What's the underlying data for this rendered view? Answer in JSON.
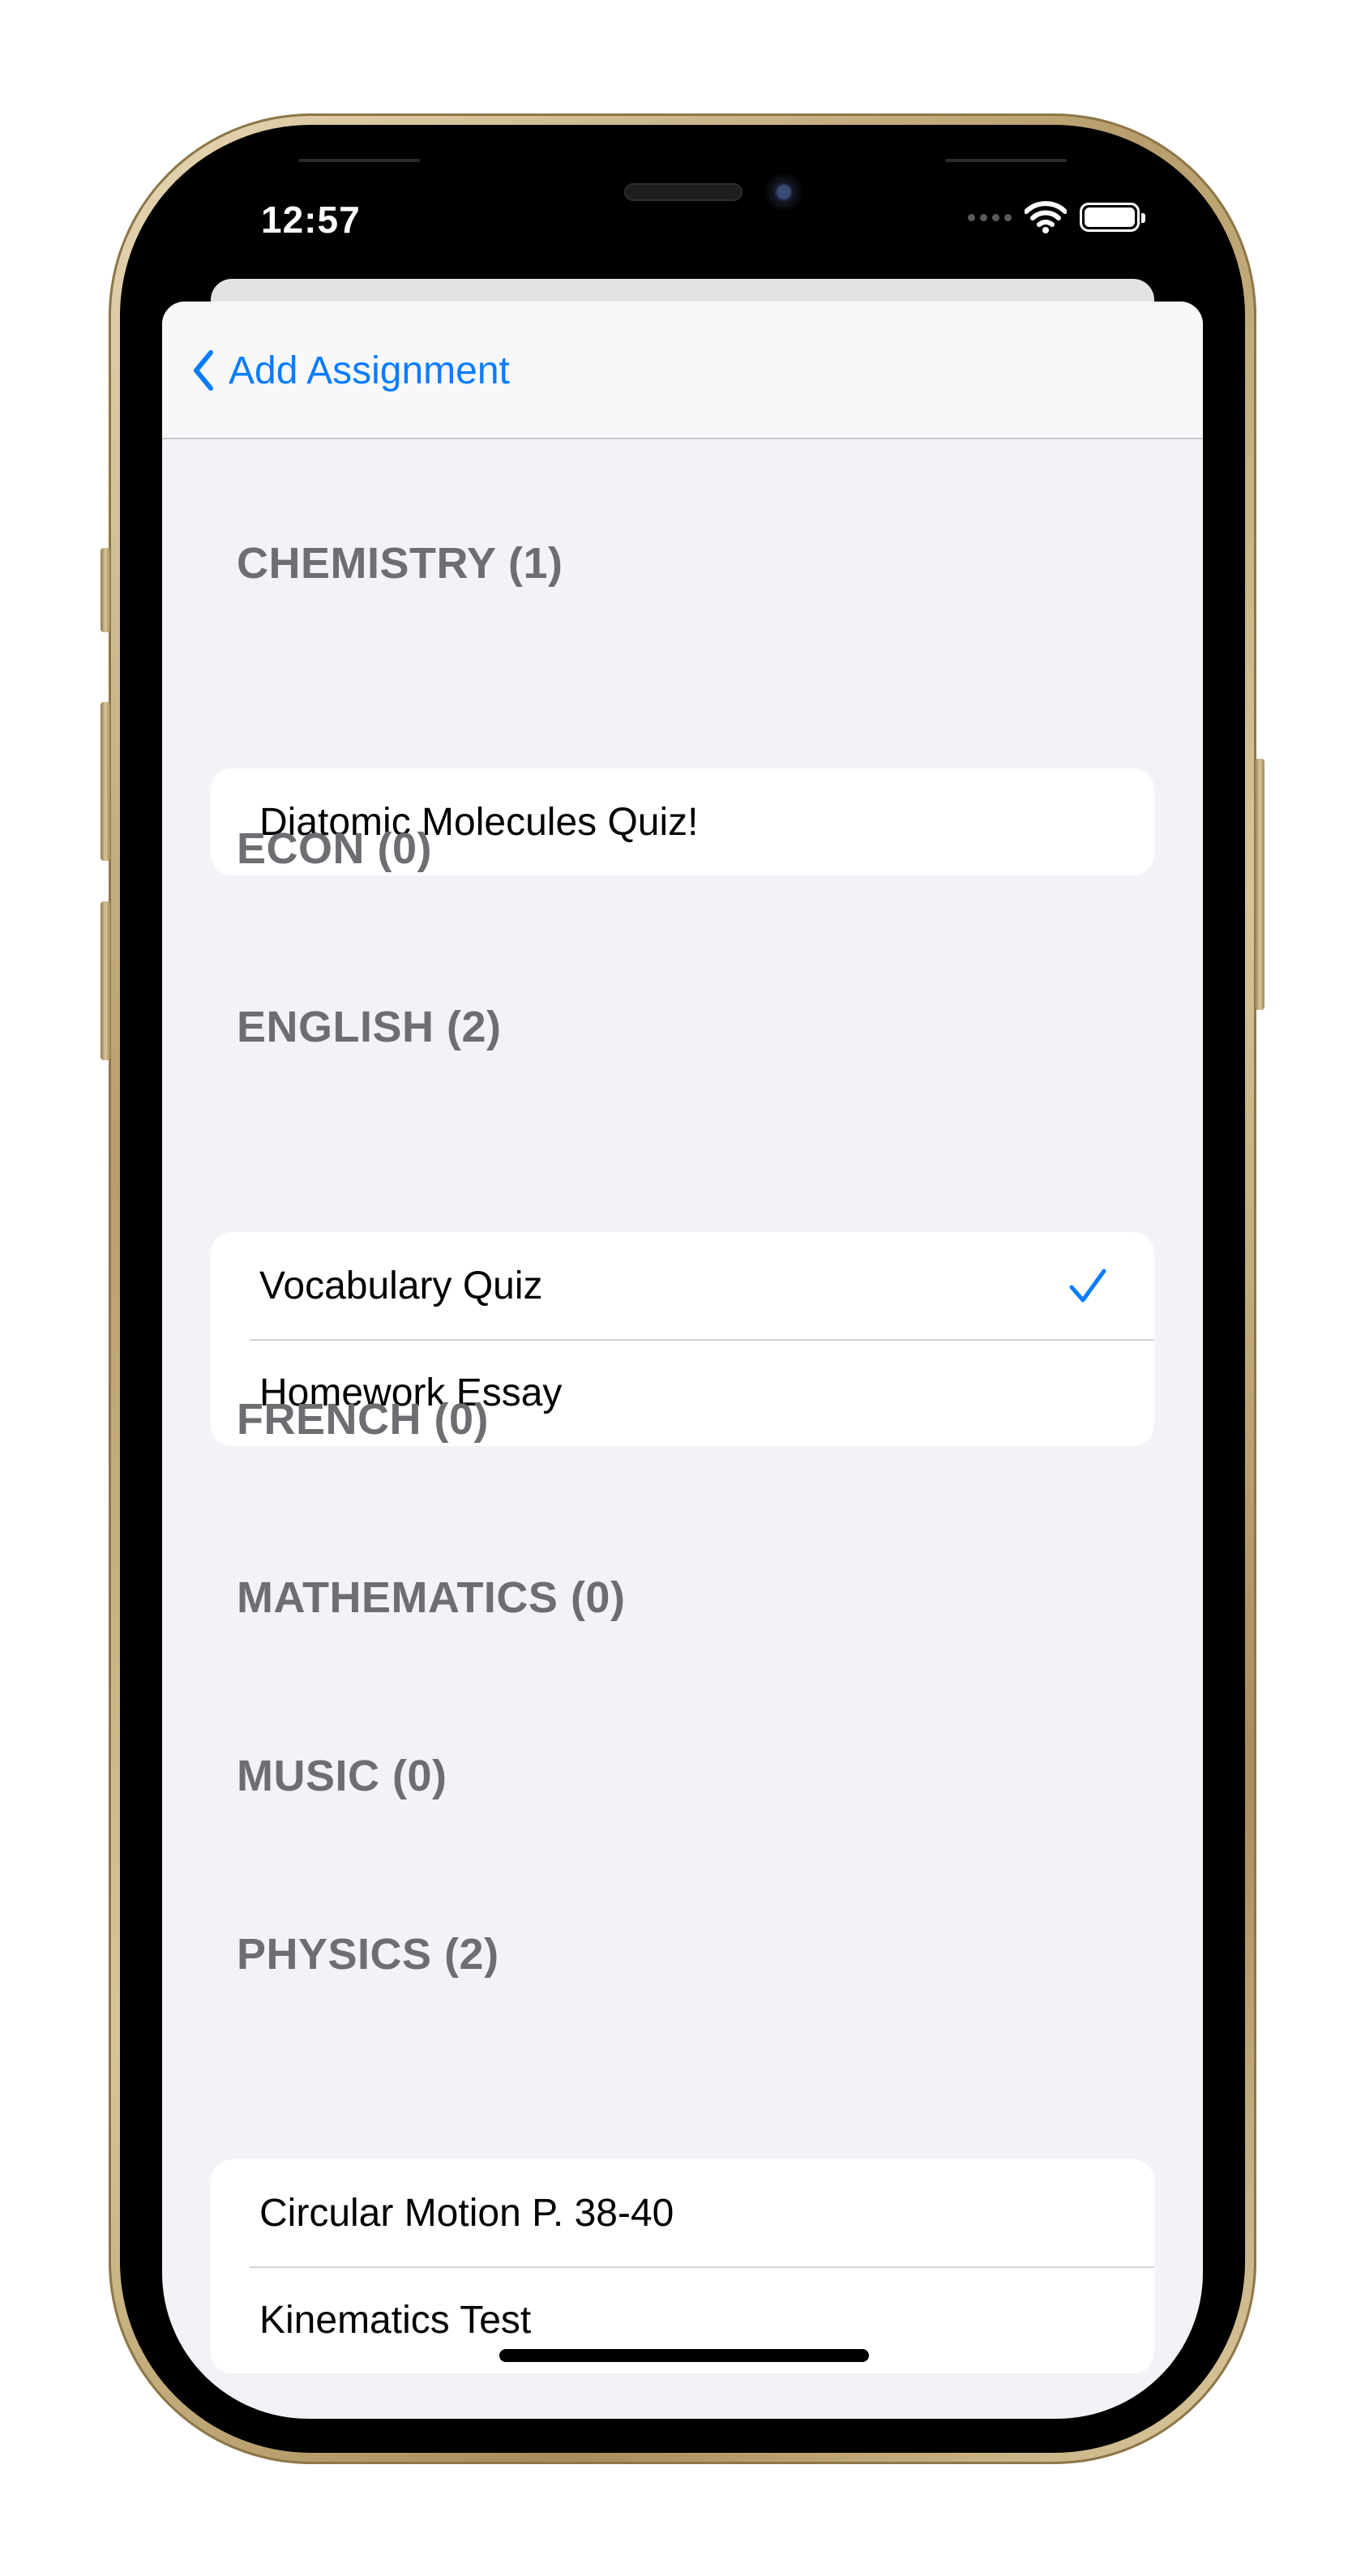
{
  "status_bar": {
    "time": "12:57"
  },
  "nav": {
    "back_label": "Add Assignment"
  },
  "sections": [
    {
      "title": "CHEMISTRY (1)",
      "items": [
        {
          "label": "Diatomic Molecules Quiz!",
          "checked": false
        }
      ]
    },
    {
      "title": "ECON (0)",
      "items": []
    },
    {
      "title": "ENGLISH (2)",
      "items": [
        {
          "label": "Vocabulary Quiz",
          "checked": true
        },
        {
          "label": "Homework Essay",
          "checked": false
        }
      ]
    },
    {
      "title": "FRENCH (0)",
      "items": []
    },
    {
      "title": "MATHEMATICS (0)",
      "items": []
    },
    {
      "title": "MUSIC (0)",
      "items": []
    },
    {
      "title": "PHYSICS (2)",
      "items": [
        {
          "label": "Circular Motion P. 38-40",
          "checked": false
        },
        {
          "label": "Kinematics Test",
          "checked": false
        }
      ]
    }
  ],
  "colors": {
    "accent": "#0a7cff",
    "section_header": "#6d6d72",
    "background": "#f2f2f7"
  },
  "icons": {
    "back": "chevron-left-icon",
    "check": "checkmark-icon",
    "wifi": "wifi-icon",
    "battery": "battery-icon"
  }
}
